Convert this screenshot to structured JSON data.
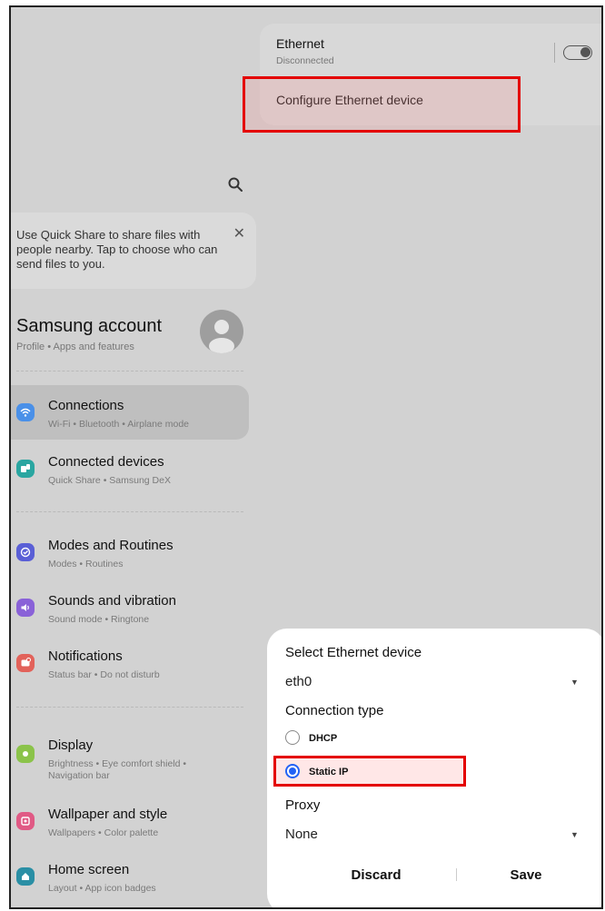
{
  "ethernet": {
    "title": "Ethernet",
    "status": "Disconnected",
    "configure_label": "Configure Ethernet device"
  },
  "quick_share": {
    "message": "Use Quick Share to share files with people nearby. Tap to choose who can send files to you."
  },
  "account": {
    "title": "Samsung account",
    "subtitle": "Profile  •  Apps and features"
  },
  "settings": [
    {
      "title": "Connections",
      "subtitle": "Wi-Fi  •  Bluetooth  •  Airplane mode",
      "icon": "wifi-icon",
      "color": "#4a90e8"
    },
    {
      "title": "Connected devices",
      "subtitle": "Quick Share  •  Samsung DeX",
      "icon": "connected-devices-icon",
      "color": "#2aa6a1"
    },
    {
      "title": "Modes and Routines",
      "subtitle": "Modes  •  Routines",
      "icon": "modes-icon",
      "color": "#5a5fd6"
    },
    {
      "title": "Sounds and vibration",
      "subtitle": "Sound mode  •  Ringtone",
      "icon": "sound-icon",
      "color": "#8a62d8"
    },
    {
      "title": "Notifications",
      "subtitle": "Status bar  •  Do not disturb",
      "icon": "notification-icon",
      "color": "#e2625a"
    },
    {
      "title": "Display",
      "subtitle": "Brightness  •  Eye comfort shield  •  Navigation bar",
      "icon": "display-icon",
      "color": "#8bc34a"
    },
    {
      "title": "Wallpaper and style",
      "subtitle": "Wallpapers  •  Color palette",
      "icon": "wallpaper-icon",
      "color": "#e05a85"
    },
    {
      "title": "Home screen",
      "subtitle": "Layout  •  App icon badges",
      "icon": "home-icon",
      "color": "#2a8fa5"
    }
  ],
  "dialog": {
    "device_heading": "Select Ethernet device",
    "device_value": "eth0",
    "connection_heading": "Connection type",
    "option_dhcp": "DHCP",
    "option_static": "Static IP",
    "proxy_heading": "Proxy",
    "proxy_value": "None",
    "discard_label": "Discard",
    "save_label": "Save",
    "caret": "▼"
  },
  "icons": {
    "close": "✕"
  },
  "colors": {
    "highlight": "#e40000",
    "radio_selected": "#2362f5"
  }
}
